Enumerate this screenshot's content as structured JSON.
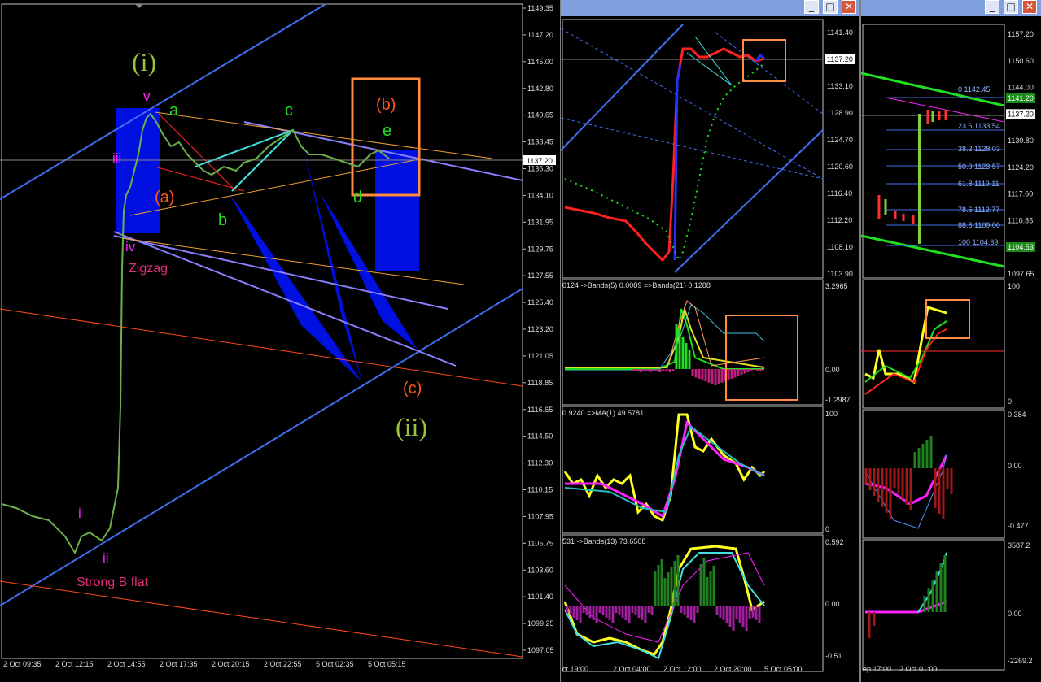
{
  "main_chart": {
    "price_ticks": [
      "1149.35",
      "1147.20",
      "1145.00",
      "1142.80",
      "1140.65",
      "1138.45",
      "1136.30",
      "1134.10",
      "1131.95",
      "1129.75",
      "1127.55",
      "1125.40",
      "1123.20",
      "1121.05",
      "1118.85",
      "1116.65",
      "1114.50",
      "1112.30",
      "1110.15",
      "1107.95",
      "1105.75",
      "1103.60",
      "1101.40",
      "1099.25",
      "1097.05"
    ],
    "current_price": "1137.20",
    "time_ticks": [
      "2 Oct 09:35",
      "2 Oct 12:15",
      "2 Oct 14:55",
      "2 Oct 17:35",
      "2 Oct 20:15",
      "2 Oct 22:55",
      "5 Oct 02:35",
      "5 Oct 05:15"
    ],
    "labels": {
      "wave_i_big": "(i)",
      "wave_ii_big": "(ii)",
      "wave_a_paren": "(a)",
      "wave_b_paren": "(b)",
      "wave_c_paren": "(c)",
      "wave_a": "a",
      "wave_b": "b",
      "wave_c": "c",
      "wave_d": "d",
      "wave_e": "e",
      "wave_i_small": "i",
      "wave_ii_small": "ii",
      "wave_iii": "iii",
      "wave_iv": "iv",
      "wave_v": "v",
      "zigzag": "Zigzag",
      "strong_b_flat": "Strong B flat"
    }
  },
  "middle_window": {
    "buttons": {
      "minimize": "_",
      "maximize": "□",
      "close": "✕"
    },
    "price_ticks": [
      "1141.40",
      "1137.20",
      "1133.10",
      "1128.90",
      "1124.70",
      "1120.60",
      "1116.40",
      "1112.20",
      "1108.10",
      "1103.90"
    ],
    "current_price": "1137.20",
    "indicator1": {
      "title": "0124  ->Bands(5) 0.0089  =>Bands(21) 0.1288",
      "ticks": [
        "3.2965",
        "0.00",
        "-1.2987"
      ]
    },
    "indicator2": {
      "title": "0.9240  =>MA(1) 49.5781",
      "ticks": [
        "100",
        "0"
      ]
    },
    "indicator3": {
      "title": "531  ->Bands(13) 73.6508",
      "ticks": [
        "0.592",
        "0.00",
        "-0.51"
      ]
    },
    "time_ticks": [
      "ct 19:00",
      "2 Oct 04:00",
      "2 Oct 12:00",
      "2 Oct 20:00",
      "5 Oct 05:00"
    ]
  },
  "right_window": {
    "buttons": {
      "minimize": "_",
      "maximize": "□",
      "close": "✕"
    },
    "price_ticks": [
      "1157.20",
      "1150.60",
      "1144.00",
      "1137.20",
      "1130.80",
      "1124.20",
      "1117.60",
      "1110.85",
      "1104.53",
      "1097.65"
    ],
    "current_price": "1137.20",
    "highlight_prices": [
      "1141.20",
      "1104.53"
    ],
    "fib_levels": [
      "0 1142.45",
      "23.6 1133.54",
      "38.2 1128.03",
      "50.0 1123.57",
      "61.8 1119.11",
      "78.6 1112.77",
      "88.6 1109.00",
      "100 1104.69"
    ],
    "indicator1_ticks": [
      "100",
      "0"
    ],
    "indicator2_ticks": [
      "0.384",
      "0.00",
      "-0.477"
    ],
    "indicator3_ticks": [
      "3587.2",
      "0.00",
      "-2269.2"
    ],
    "time_ticks": [
      "ep 17:00",
      "2 Oct 01:00"
    ]
  }
}
